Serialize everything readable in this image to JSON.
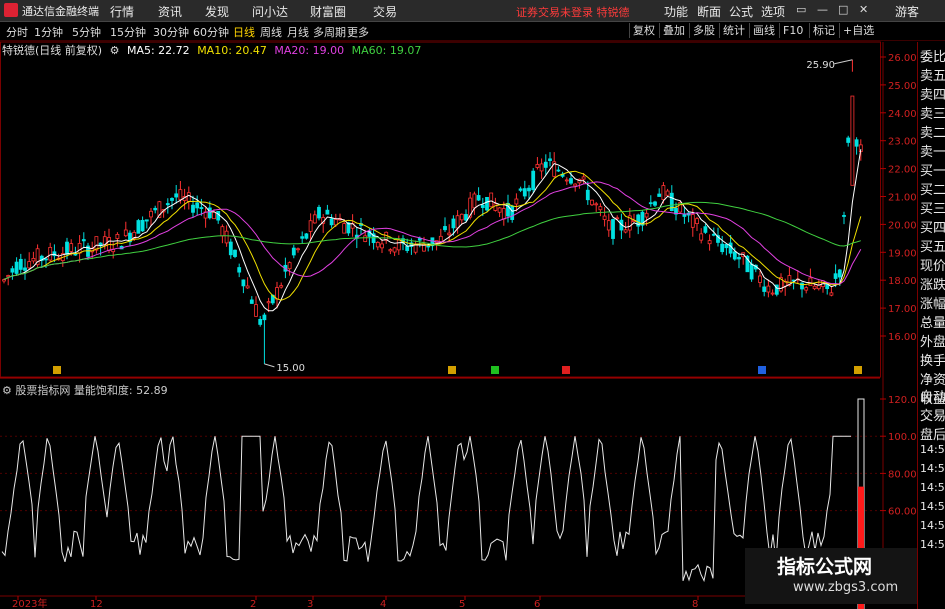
{
  "app": {
    "title": "通达信金融终端"
  },
  "menu": [
    "行情",
    "资讯",
    "发现",
    "问小达",
    "财富圈",
    "交易"
  ],
  "login_text": "证券交易未登录  特锐德",
  "right_tools": [
    "功能",
    "断面",
    "公式",
    "选项"
  ],
  "guest": "游客",
  "periods": [
    "分时",
    "1分钟",
    "5分钟",
    "15分钟",
    "30分钟",
    "60分钟",
    "日线",
    "周线",
    "月线",
    "多周期",
    "更多"
  ],
  "active_period": "日线",
  "toolbar_buttons": [
    "复权",
    "叠加",
    "多股",
    "统计",
    "画线",
    "F10",
    "标记",
    "+自选"
  ],
  "legend": {
    "stock": "特锐德(日线 前复权)",
    "ma5": "MA5: 22.72",
    "ma10": "MA10: 20.47",
    "ma20": "MA20: 19.00",
    "ma60": "MA60: 19.07"
  },
  "price_axis": [
    "26.00",
    "25.00",
    "24.00",
    "23.00",
    "22.00",
    "21.00",
    "20.00",
    "19.00",
    "18.00",
    "17.00",
    "16.00"
  ],
  "annotations": {
    "high": "25.90",
    "low": "15.00"
  },
  "side_labels": [
    "委比",
    "卖五",
    "卖四",
    "卖三",
    "卖二",
    "卖一",
    "买一",
    "买二",
    "买三",
    "买四",
    "买五",
    "现价",
    "涨跌",
    "涨幅",
    "总量",
    "外盘",
    "换手",
    "净资",
    "收益",
    "自动",
    "交易",
    "盘后",
    "14:50",
    "14:50",
    "14:50",
    "14:50",
    "14:50",
    "14:50"
  ],
  "indicator": {
    "legend": "股票指标网  量能饱和度: 52.89",
    "axis": [
      "120.00",
      "100.00",
      "80.00",
      "60.00"
    ],
    "value": 52.89
  },
  "x_labels": [
    "2023年",
    "12",
    "2",
    "3",
    "4",
    "5",
    "6",
    "8"
  ],
  "watermark": {
    "title": "指标公式网",
    "url": "www.zbgs3.com"
  },
  "colors": {
    "up": "#ff3232",
    "down": "#00e0e0",
    "ma5": "#ffffff",
    "ma10": "#f0e000",
    "ma20": "#e040e0",
    "ma60": "#40d040",
    "grid": "#7a0000"
  }
}
